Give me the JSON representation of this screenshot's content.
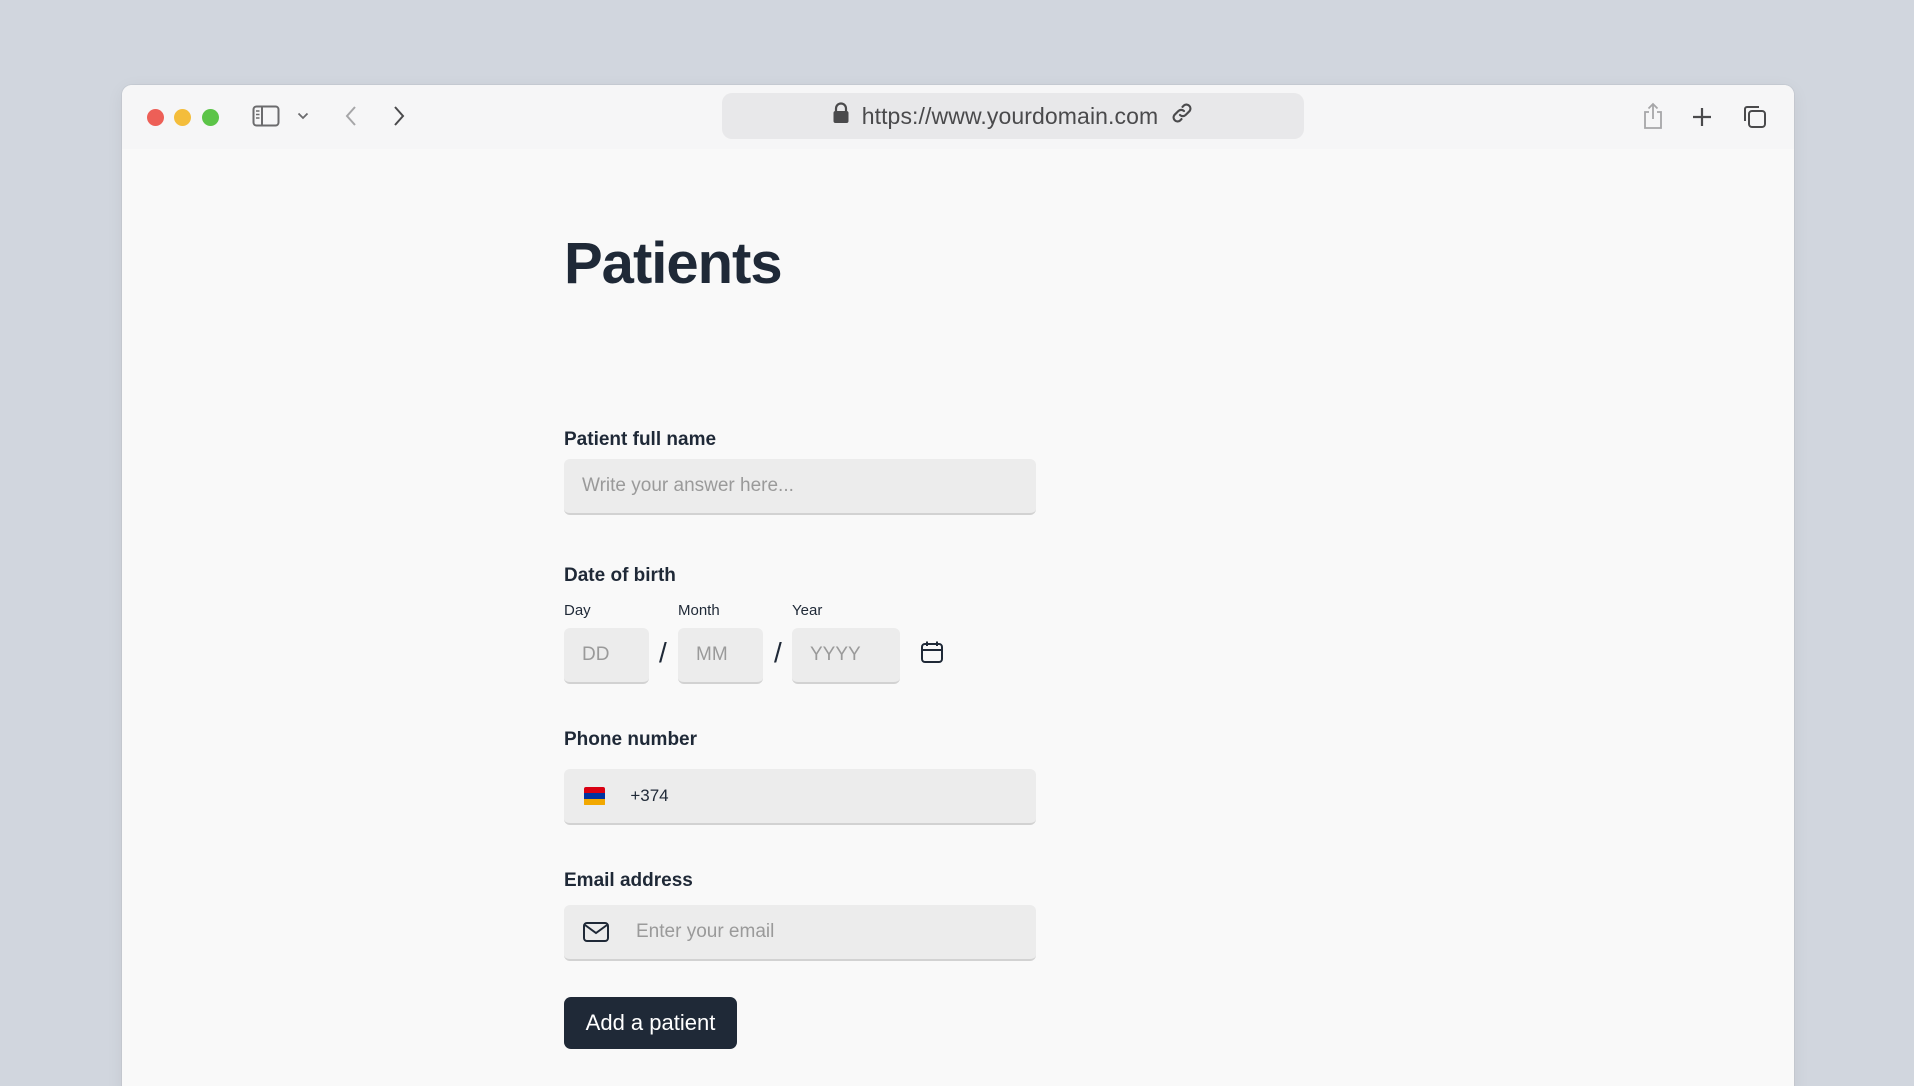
{
  "browser": {
    "url": "https://www.yourdomain.com"
  },
  "page": {
    "title": "Patients"
  },
  "form": {
    "name": {
      "label": "Patient full name",
      "placeholder": "Write your answer here..."
    },
    "dob": {
      "label": "Date of birth",
      "day_label": "Day",
      "day_placeholder": "DD",
      "month_label": "Month",
      "month_placeholder": "MM",
      "year_label": "Year",
      "year_placeholder": "YYYY",
      "separator": "/"
    },
    "phone": {
      "label": "Phone number",
      "country_code": "+374",
      "flag_colors": [
        "#d90012",
        "#0033a0",
        "#f2a800"
      ]
    },
    "email": {
      "label": "Email address",
      "placeholder": "Enter your email"
    },
    "submit_label": "Add a patient"
  }
}
